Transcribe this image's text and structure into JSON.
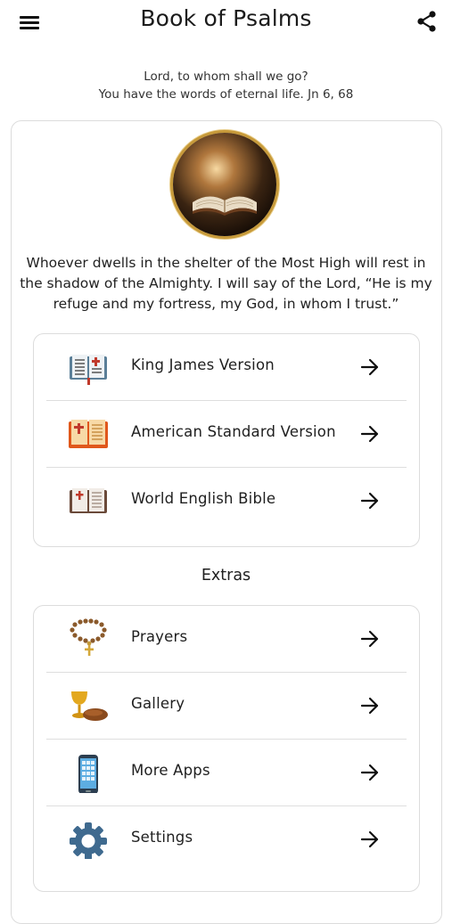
{
  "app_title": "Book of Psalms",
  "header_quote": {
    "line1": "Lord, to whom shall we go?",
    "line2": "You have the words of eternal life. Jn 6, 68"
  },
  "verse": "Whoever dwells in the shelter of the Most High will rest in the shadow of the Almighty. I will say of the Lord, “He is my refuge and my fortress, my God, in whom I trust.”",
  "bibles": [
    {
      "label": "King James Version",
      "icon": "bible-icon"
    },
    {
      "label": "American Standard Version",
      "icon": "open-bible-icon"
    },
    {
      "label": "World English Bible",
      "icon": "closed-bible-icon"
    }
  ],
  "extras_title": "Extras",
  "extras": [
    {
      "label": "Prayers",
      "icon": "rosary-icon"
    },
    {
      "label": "Gallery",
      "icon": "chalice-bread-icon"
    },
    {
      "label": "More Apps",
      "icon": "phone-icon"
    },
    {
      "label": "Settings",
      "icon": "gear-icon"
    }
  ]
}
